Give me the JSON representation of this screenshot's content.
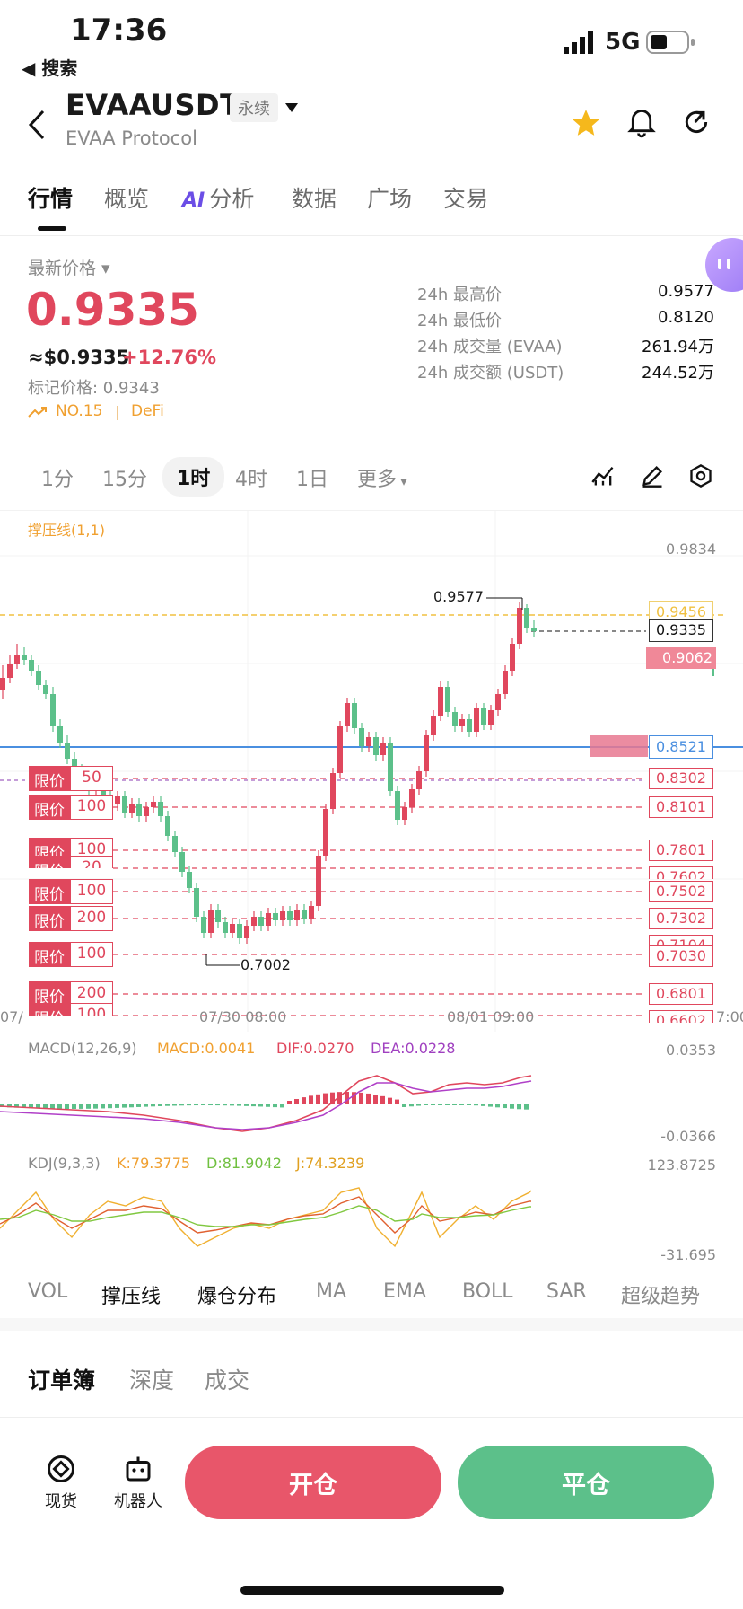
{
  "status": {
    "time": "17:36",
    "back_app": "◀ 搜索",
    "network": "5G"
  },
  "header": {
    "symbol": "EVAAUSDT",
    "contract_type": "永续",
    "subtitle": "EVAA Protocol"
  },
  "tabs": [
    {
      "label": "行情",
      "active": true
    },
    {
      "label": "概览"
    },
    {
      "label": "分析",
      "prefix": "AI"
    },
    {
      "label": "数据"
    },
    {
      "label": "广场"
    },
    {
      "label": "交易"
    }
  ],
  "price": {
    "label": "最新价格",
    "last": "0.9335",
    "usd": "≈$0.9335",
    "change": "+12.76%",
    "mark_label": "标记价格: 0.9343",
    "rank": "NO.15",
    "sector": "DeFi"
  },
  "stats": [
    {
      "label": "24h 最高价",
      "value": "0.9577"
    },
    {
      "label": "24h 最低价",
      "value": "0.8120"
    },
    {
      "label": "24h 成交量 (EVAA)",
      "value": "261.94万"
    },
    {
      "label": "24h 成交额 (USDT)",
      "value": "244.52万"
    }
  ],
  "timeframes": [
    {
      "label": "1分"
    },
    {
      "label": "15分"
    },
    {
      "label": "1时",
      "active": true
    },
    {
      "label": "4时"
    },
    {
      "label": "1日"
    },
    {
      "label": "更多"
    }
  ],
  "chart": {
    "indicator_label": "撑压线(1,1)",
    "price_axis": [
      "0.9834",
      "0.9456",
      "0.9335",
      "0.9062",
      "0.8521",
      "0.8302",
      "0.8101",
      "0.7801",
      "0.7602",
      "0.7502",
      "0.7302",
      "0.7104",
      "0.7030",
      "0.6801",
      "0.6602"
    ],
    "high_marker": "0.9577",
    "low_marker": "0.7002",
    "time_labels": [
      "07/",
      "07/30 08:00",
      "08/01 09:00",
      "7:00"
    ],
    "orders": [
      {
        "side": "限价",
        "qty": "50"
      },
      {
        "side": "限价",
        "qty": "100"
      },
      {
        "side": "限价",
        "qty": "100"
      },
      {
        "side": "限价",
        "qty": "20"
      },
      {
        "side": "限价",
        "qty": "100"
      },
      {
        "side": "限价",
        "qty": "200"
      },
      {
        "side": "限价",
        "qty": "100"
      },
      {
        "side": "限价",
        "qty": "200"
      },
      {
        "side": "限价",
        "qty": "100"
      }
    ],
    "macd": {
      "label": "MACD(12,26,9)",
      "macd": "MACD:0.0041",
      "dif": "DIF:0.0270",
      "dea": "DEA:0.0228",
      "max": "0.0353",
      "min": "-0.0366"
    },
    "kdj": {
      "label": "KDJ(9,3,3)",
      "k": "K:79.3775",
      "d": "D:81.9042",
      "j": "J:74.3239",
      "max": "123.8725",
      "min": "-31.695"
    }
  },
  "indicator_tabs": [
    "VOL",
    "撑压线",
    "爆仓分布",
    "MA",
    "EMA",
    "BOLL",
    "SAR",
    "超级趋势"
  ],
  "orderbook_tabs": [
    "订单簿",
    "深度",
    "成交"
  ],
  "bottom": {
    "spot": "现货",
    "bot": "机器人",
    "open": "开仓",
    "close": "平仓"
  },
  "colors": {
    "up": "#e0475d",
    "down": "#5cc08a",
    "accent_orange": "#f0a030",
    "support_blue": "#4a8fe0"
  }
}
